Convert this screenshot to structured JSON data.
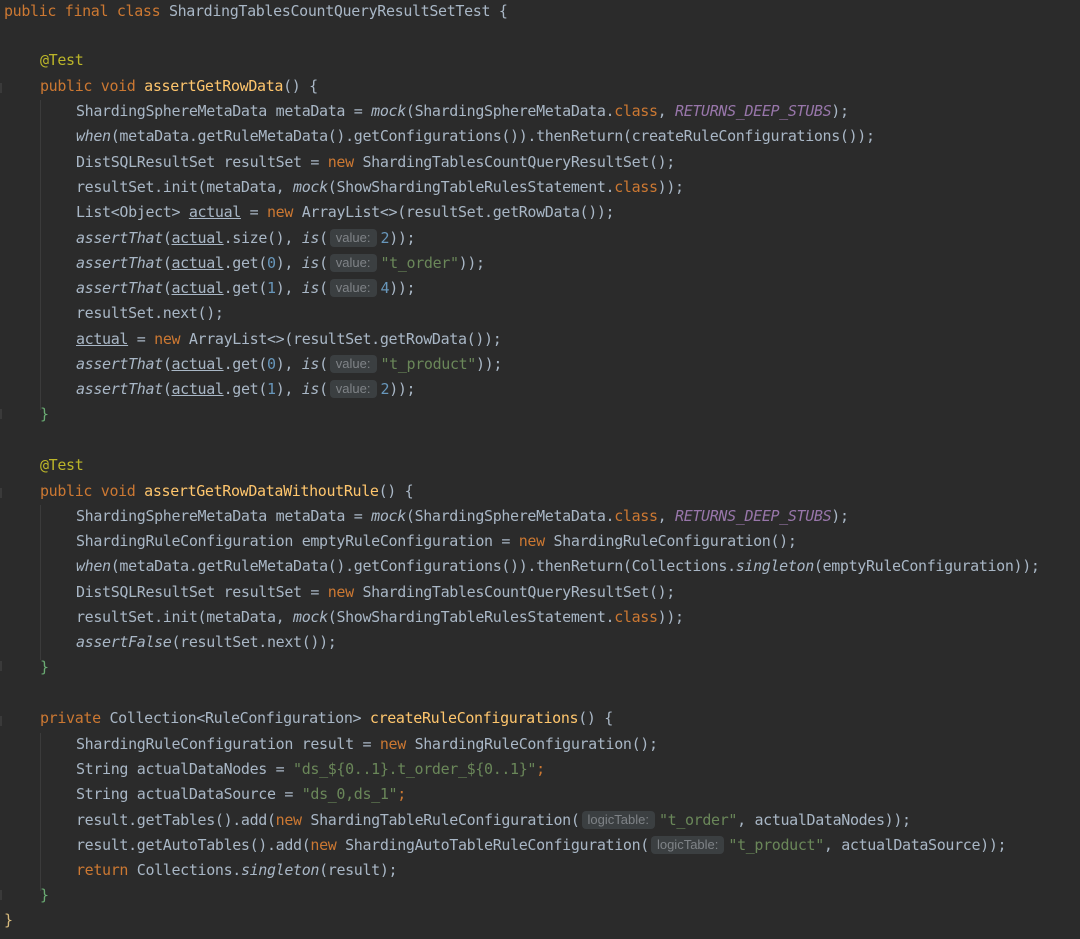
{
  "editor": {
    "title": "ShardingTablesCountQueryResultSetTest",
    "colors": {
      "background": "#2b2b2b",
      "keyword": "#cc7832",
      "method": "#ffc66d",
      "annotation": "#bbb529",
      "string": "#6a8759",
      "number": "#6897bb",
      "constant": "#9876aa",
      "text": "#a9b7c6",
      "hint_bg": "#3b3f41",
      "hint_text": "#7f8387"
    }
  },
  "code": {
    "l1": {
      "kw1": "public final class ",
      "name": "ShardingTablesCountQueryResultSetTest",
      "rest": " {"
    },
    "l3": {
      "ann": "@Test"
    },
    "l4": {
      "kw": "public void ",
      "fn": "assertGetRowData",
      "rest": "() {"
    },
    "l5": {
      "a": "ShardingSphereMetaData metaData = ",
      "b": "mock",
      "c": "(ShardingSphereMetaData.",
      "d": "class",
      "e": ", ",
      "f": "RETURNS_DEEP_STUBS",
      "g": ");"
    },
    "l6": {
      "a": "when",
      "b": "(metaData.getRuleMetaData().getConfigurations()).thenReturn(createRuleConfigurations());"
    },
    "l7": {
      "a": "DistSQLResultSet resultSet = ",
      "b": "new ",
      "c": "ShardingTablesCountQueryResultSet();"
    },
    "l8": {
      "a": "resultSet.init(metaData, ",
      "b": "mock",
      "c": "(ShowShardingTableRulesStatement.",
      "d": "class",
      "e": "));"
    },
    "l9": {
      "a": "List<Object> ",
      "b": "actual",
      "c": " = ",
      "d": "new ",
      "e": "ArrayList<>(resultSet.getRowData());"
    },
    "l10": {
      "a": "assertThat",
      "b": "(",
      "c": "actual",
      "d": ".size(), ",
      "e": "is",
      "f": "(",
      "hint": "value:",
      "g": "2",
      "h": "));"
    },
    "l11": {
      "a": "assertThat",
      "b": "(",
      "c": "actual",
      "d": ".get(",
      "n": "0",
      "d2": "), ",
      "e": "is",
      "f": "(",
      "hint": "value:",
      "g": "\"t_order\"",
      "h": "));"
    },
    "l12": {
      "a": "assertThat",
      "b": "(",
      "c": "actual",
      "d": ".get(",
      "n": "1",
      "d2": "), ",
      "e": "is",
      "f": "(",
      "hint": "value:",
      "g": "4",
      "h": "));"
    },
    "l13": {
      "a": "resultSet.next();"
    },
    "l14": {
      "a": "actual",
      "b": " = ",
      "c": "new ",
      "d": "ArrayList<>(resultSet.getRowData());"
    },
    "l15": {
      "a": "assertThat",
      "b": "(",
      "c": "actual",
      "d": ".get(",
      "n": "0",
      "d2": "), ",
      "e": "is",
      "f": "(",
      "hint": "value:",
      "g": "\"t_product\"",
      "h": "));"
    },
    "l16": {
      "a": "assertThat",
      "b": "(",
      "c": "actual",
      "d": ".get(",
      "n": "1",
      "d2": "), ",
      "e": "is",
      "f": "(",
      "hint": "value:",
      "g": "2",
      "h": "));"
    },
    "l17": {
      "a": "}"
    },
    "l19": {
      "ann": "@Test"
    },
    "l20": {
      "kw": "public void ",
      "fn": "assertGetRowDataWithoutRule",
      "rest": "() {"
    },
    "l21": {
      "a": "ShardingSphereMetaData metaData = ",
      "b": "mock",
      "c": "(ShardingSphereMetaData.",
      "d": "class",
      "e": ", ",
      "f": "RETURNS_DEEP_STUBS",
      "g": ");"
    },
    "l22": {
      "a": "ShardingRuleConfiguration emptyRuleConfiguration = ",
      "b": "new ",
      "c": "ShardingRuleConfiguration();"
    },
    "l23": {
      "a": "when",
      "b": "(metaData.getRuleMetaData().getConfigurations()).thenReturn(Collections.",
      "c": "singleton",
      "d": "(emptyRuleConfiguration));"
    },
    "l24": {
      "a": "DistSQLResultSet resultSet = ",
      "b": "new ",
      "c": "ShardingTablesCountQueryResultSet();"
    },
    "l25": {
      "a": "resultSet.init(metaData, ",
      "b": "mock",
      "c": "(ShowShardingTableRulesStatement.",
      "d": "class",
      "e": "));"
    },
    "l26": {
      "a": "assertFalse",
      "b": "(resultSet.next());"
    },
    "l27": {
      "a": "}"
    },
    "l29": {
      "kw": "private ",
      "type": "Collection<RuleConfiguration> ",
      "fn": "createRuleConfigurations",
      "rest": "() {"
    },
    "l30": {
      "a": "ShardingRuleConfiguration result = ",
      "b": "new ",
      "c": "ShardingRuleConfiguration();"
    },
    "l31": {
      "a": "String actualDataNodes = ",
      "b": "\"ds_${0..1}.t_order_${0..1}\"",
      "c": ";"
    },
    "l32": {
      "a": "String actualDataSource = ",
      "b": "\"ds_0,ds_1\"",
      "c": ";"
    },
    "l33": {
      "a": "result.getTables().add(",
      "b": "new ",
      "c": "ShardingTableRuleConfiguration(",
      "hint": "logicTable:",
      "d": "\"t_order\"",
      "e": ", actualDataNodes));"
    },
    "l34": {
      "a": "result.getAutoTables().add(",
      "b": "new ",
      "c": "ShardingAutoTableRuleConfiguration(",
      "hint": "logicTable:",
      "d": "\"t_product\"",
      "e": ", actualDataSource));"
    },
    "l35": {
      "a": "return ",
      "b": "Collections.",
      "c": "singleton",
      "d": "(result);"
    },
    "l36": {
      "a": "}"
    },
    "l37": {
      "a": "}"
    }
  }
}
